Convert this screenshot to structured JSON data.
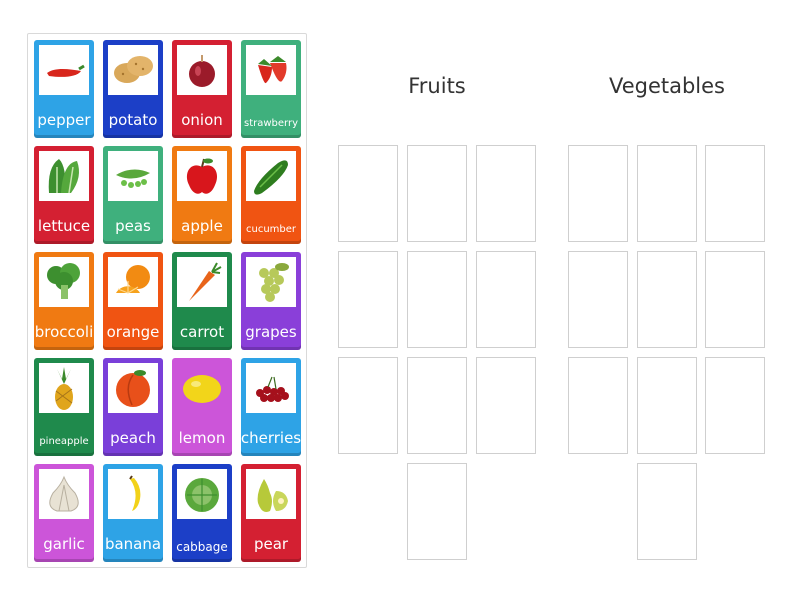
{
  "bank": {
    "tiles": [
      {
        "label": "pepper",
        "color": "#2ea3e6",
        "icon": "chili-pepper-icon"
      },
      {
        "label": "potato",
        "color": "#1c3fc7",
        "icon": "potato-icon"
      },
      {
        "label": "onion",
        "color": "#d42032",
        "icon": "onion-icon"
      },
      {
        "label": "strawberry",
        "color": "#3fb07d",
        "icon": "strawberry-icon"
      },
      {
        "label": "lettuce",
        "color": "#d42032",
        "icon": "lettuce-icon"
      },
      {
        "label": "peas",
        "color": "#3fb07d",
        "icon": "peas-icon"
      },
      {
        "label": "apple",
        "color": "#f07a12",
        "icon": "apple-icon"
      },
      {
        "label": "cucumber",
        "color": "#f05412",
        "icon": "cucumber-icon"
      },
      {
        "label": "broccoli",
        "color": "#f07a12",
        "icon": "broccoli-icon"
      },
      {
        "label": "orange",
        "color": "#f05412",
        "icon": "orange-icon"
      },
      {
        "label": "carrot",
        "color": "#1f8a4c",
        "icon": "carrot-icon"
      },
      {
        "label": "grapes",
        "color": "#8a3fd9",
        "icon": "grapes-icon"
      },
      {
        "label": "pineapple",
        "color": "#1f8a4c",
        "icon": "pineapple-icon"
      },
      {
        "label": "peach",
        "color": "#7a3fd9",
        "icon": "peach-icon"
      },
      {
        "label": "lemon",
        "color": "#cc55d9",
        "icon": "lemon-icon"
      },
      {
        "label": "cherries",
        "color": "#2ea3e6",
        "icon": "cherries-icon"
      },
      {
        "label": "garlic",
        "color": "#cc55d9",
        "icon": "garlic-icon"
      },
      {
        "label": "banana",
        "color": "#2ea3e6",
        "icon": "banana-icon"
      },
      {
        "label": "cabbage",
        "color": "#1c3fc7",
        "icon": "cabbage-icon"
      },
      {
        "label": "pear",
        "color": "#d42032",
        "icon": "pear-icon"
      }
    ]
  },
  "groups": {
    "fruits": {
      "title": "Fruits",
      "slot_count": 10
    },
    "vegetables": {
      "title": "Vegetables",
      "slot_count": 10
    }
  }
}
